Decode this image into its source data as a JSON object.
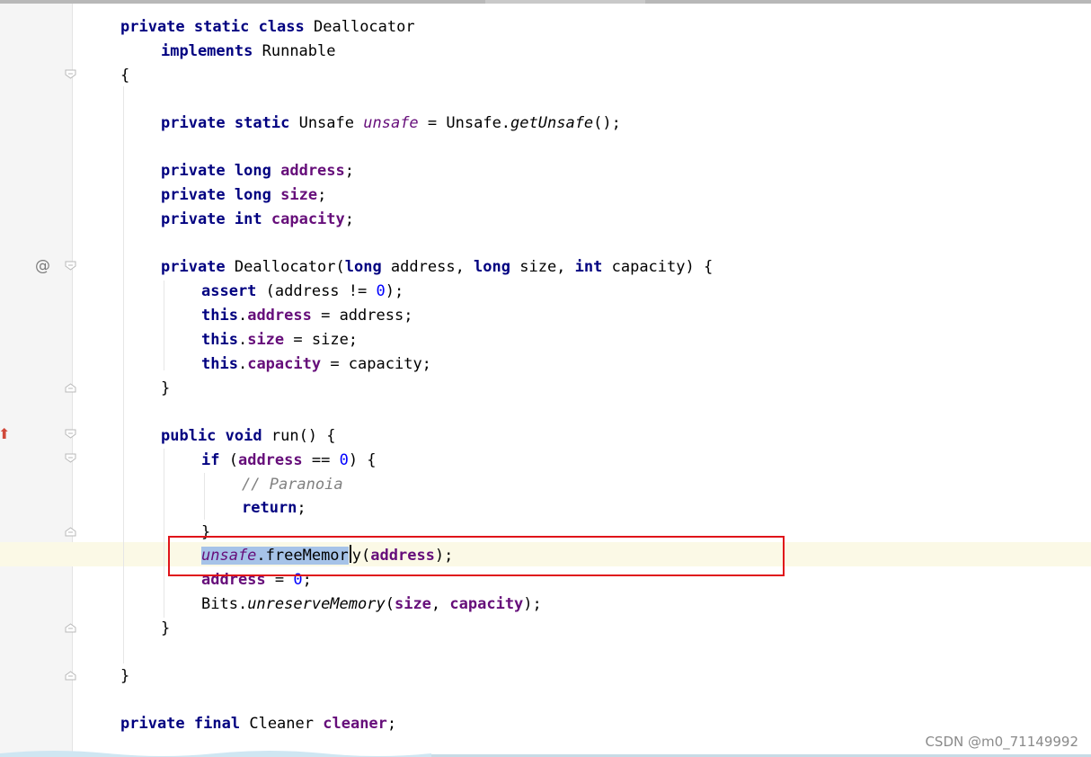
{
  "code": {
    "class_decl": {
      "kw1": "private",
      "kw2": "static",
      "kw3": "class",
      "name": "Deallocator"
    },
    "implements_line": {
      "kw": "implements",
      "name": "Runnable"
    },
    "open_brace": "{",
    "unsafe_field": {
      "kw1": "private",
      "kw2": "static",
      "type": "Unsafe",
      "name": "unsafe",
      "eq": " = ",
      "cls": "Unsafe.",
      "call": "getUnsafe",
      "tail": "();"
    },
    "address_field": {
      "kw1": "private",
      "kw2": "long",
      "name": "address",
      "tail": ";"
    },
    "size_field": {
      "kw1": "private",
      "kw2": "long",
      "name": "size",
      "tail": ";"
    },
    "capacity_field": {
      "kw1": "private",
      "kw2": "int",
      "name": "capacity",
      "tail": ";"
    },
    "ctor": {
      "kw1": "private",
      "name": "Deallocator(",
      "t1": "long",
      "p1": " address, ",
      "t2": "long",
      "p2": " size, ",
      "t3": "int",
      "p3": " capacity) {"
    },
    "assert_line": {
      "kw": "assert",
      "pre": " (address != ",
      "num": "0",
      "post": ");"
    },
    "this_address": {
      "kw": "this",
      "dot": ".",
      "field": "address",
      "tail": " = address;"
    },
    "this_size": {
      "kw": "this",
      "dot": ".",
      "field": "size",
      "tail": " = size;"
    },
    "this_capacity": {
      "kw": "this",
      "dot": ".",
      "field": "capacity",
      "tail": " = capacity;"
    },
    "close_ctor": "}",
    "run_decl": {
      "kw1": "public",
      "kw2": "void",
      "rest": " run() {"
    },
    "if_line": {
      "kw": "if",
      "pre": " (",
      "field": "address",
      "mid": " == ",
      "num": "0",
      "post": ") {"
    },
    "comment_line": "// Paranoia",
    "return_line": {
      "kw": "return",
      "tail": ";"
    },
    "close_if": "}",
    "free_line": {
      "sel_field": "unsafe",
      "sel_rest": ".freeMemor",
      "after": "y(",
      "arg": "address",
      "tail": ");"
    },
    "address_reset": {
      "field": "address",
      "mid": " = ",
      "num": "0",
      "tail": ";"
    },
    "bits_line": {
      "cls": "Bits.",
      "call": "unreserveMemory",
      "pre": "(",
      "a1": "size",
      "sep": ", ",
      "a2": "capacity",
      "tail": ");"
    },
    "close_run": "}",
    "close_class": "}",
    "cleaner_field": {
      "kw1": "private",
      "kw2": "final",
      "type": "Cleaner",
      "name": "cleaner",
      "tail": ";"
    }
  },
  "gutter": {
    "override_symbol": "@",
    "impl_symbol": "⬆"
  },
  "watermark": "CSDN @m0_71149992",
  "colors": {
    "keyword": "#000080",
    "field": "#660e7a",
    "number": "#0000ff",
    "comment": "#808080",
    "highlight_box": "#e0141a",
    "selection": "#a6c3e8",
    "current_line": "#fbf9e6"
  }
}
